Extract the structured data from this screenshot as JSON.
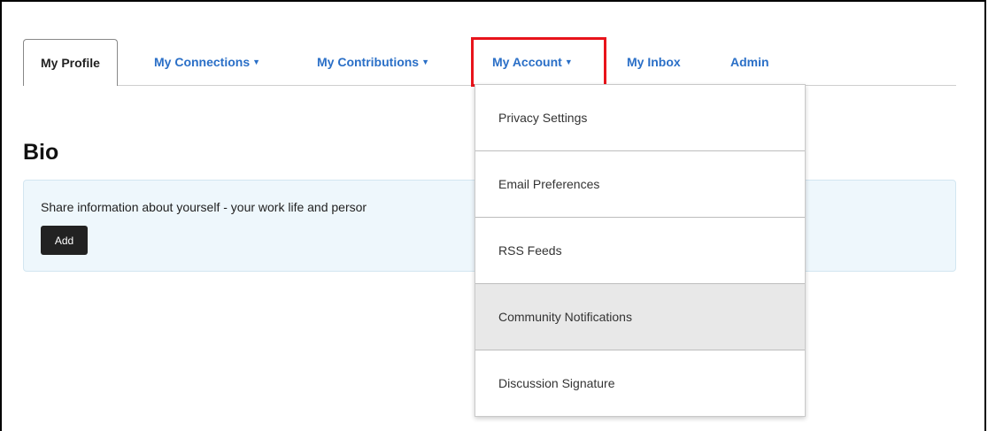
{
  "tabs": [
    {
      "label": "My Profile",
      "active": true,
      "has_caret": false
    },
    {
      "label": "My Connections",
      "active": false,
      "has_caret": true
    },
    {
      "label": "My Contributions",
      "active": false,
      "has_caret": true
    },
    {
      "label": "My Account",
      "active": false,
      "has_caret": true
    },
    {
      "label": "My Inbox",
      "active": false,
      "has_caret": false
    },
    {
      "label": "Admin",
      "active": false,
      "has_caret": false
    }
  ],
  "caret_icon": "caret-down-icon",
  "bio": {
    "title": "Bio",
    "text": "Share information about yourself - your work life and persor",
    "add_label": "Add"
  },
  "dropdown": {
    "items": [
      {
        "label": "Privacy Settings"
      },
      {
        "label": "Email Preferences"
      },
      {
        "label": "RSS Feeds"
      },
      {
        "label": "Community Notifications",
        "hovered": true
      },
      {
        "label": "Discussion Signature"
      }
    ]
  },
  "colors": {
    "link": "#2a6fc7",
    "highlight": "#e8141b",
    "bio_panel_bg": "#eef7fc",
    "hover_bg": "#e8e8e8"
  }
}
